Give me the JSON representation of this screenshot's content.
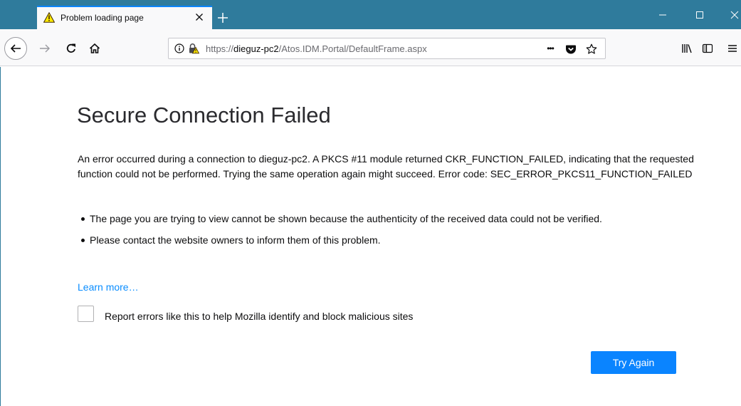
{
  "tab": {
    "title": "Problem loading page",
    "icon": "warning-icon"
  },
  "window_controls": {
    "minimize": "—",
    "maximize": "☐",
    "close": "✕"
  },
  "urlbar": {
    "scheme": "https://",
    "host": "dieguz-pc2",
    "path": "/Atos.IDM.Portal/DefaultFrame.aspx",
    "more": "•••"
  },
  "page": {
    "title": "Secure Connection Failed",
    "description": "An error occurred during a connection to dieguz-pc2. A PKCS #11 module returned CKR_FUNCTION_FAILED, indicating that the requested function could not be performed. Trying the same operation again might succeed. Error code: SEC_ERROR_PKCS11_FUNCTION_FAILED",
    "bullets": [
      "The page you are trying to view cannot be shown because the authenticity of the received data could not be verified.",
      "Please contact the website owners to inform them of this problem."
    ],
    "learn_more": "Learn more…",
    "report_label": "Report errors like this to help Mozilla identify and block malicious sites",
    "report_checked": false,
    "try_again": "Try Again"
  },
  "colors": {
    "titlebar": "#2f7b9c",
    "accent": "#0a84ff",
    "link": "#0a8dff"
  }
}
